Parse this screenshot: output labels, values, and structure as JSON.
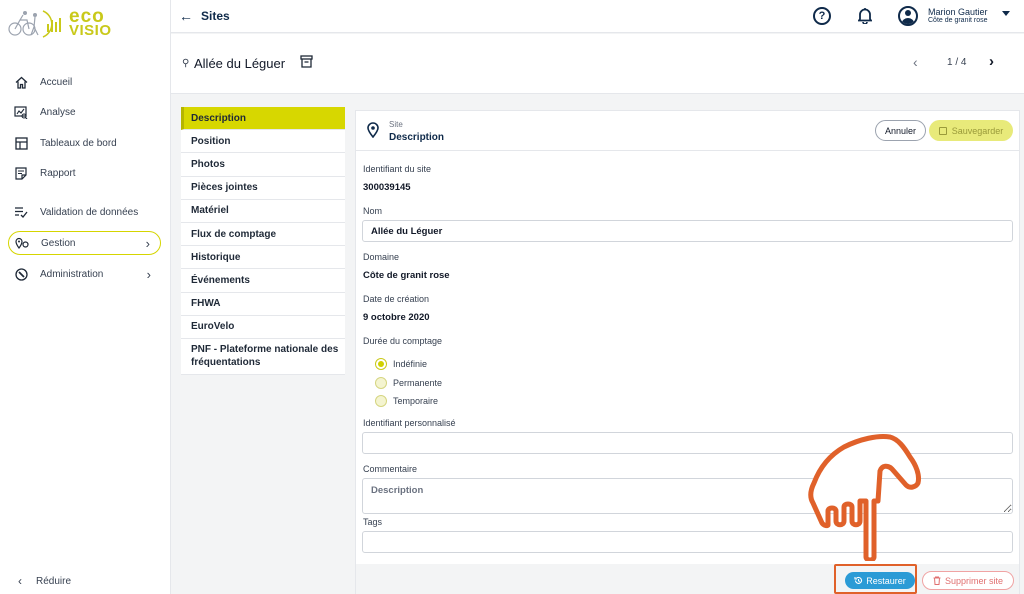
{
  "brand": {
    "word1": "eco",
    "word2": "VISIO"
  },
  "sidebar": {
    "items": [
      {
        "label": "Accueil",
        "icon": "home-icon"
      },
      {
        "label": "Analyse",
        "icon": "analysis-icon"
      },
      {
        "label": "Tableaux de bord",
        "icon": "dashboard-icon"
      },
      {
        "label": "Rapport",
        "icon": "report-icon"
      },
      {
        "label": "Validation de données",
        "icon": "validation-icon"
      },
      {
        "label": "Gestion",
        "icon": "gestion-icon",
        "active": true
      },
      {
        "label": "Administration",
        "icon": "wrench-icon"
      }
    ],
    "reduce_label": "Réduire"
  },
  "topbar": {
    "title": "Sites",
    "help_glyph": "?",
    "user_name": "Marion Gautier",
    "user_org": "Côte de granit rose"
  },
  "site": {
    "name": "Allée du Léguer",
    "pager": "1 / 4"
  },
  "tabs": [
    "Description",
    "Position",
    "Photos",
    "Pièces jointes",
    "Matériel",
    "Flux de comptage",
    "Historique",
    "Événements",
    "FHWA",
    "EuroVelo",
    "PNF - Plateforme nationale des fréquentations"
  ],
  "panel": {
    "kicker": "Site",
    "heading": "Description",
    "cancel_label": "Annuler",
    "save_label": "Sauvegarder",
    "id_label": "Identifiant du site",
    "id_value": "300039145",
    "name_label": "Nom",
    "name_value": "Allée du Léguer",
    "domain_label": "Domaine",
    "domain_value": "Côte de granit rose",
    "created_label": "Date de création",
    "created_value": "9 octobre 2020",
    "duration_label": "Durée du comptage",
    "duration_options": [
      "Indéfinie",
      "Permanente",
      "Temporaire"
    ],
    "duration_selected": "Indéfinie",
    "custom_id_label": "Identifiant personnalisé",
    "custom_id_value": "",
    "comment_label": "Commentaire",
    "comment_placeholder": "Description",
    "tags_label": "Tags",
    "tags_value": "",
    "restore_label": "Restaurer",
    "delete_label": "Supprimer site"
  },
  "colors": {
    "brand": "#c9c91a",
    "tab_active": "#d7d700",
    "navy": "#0f2a4a",
    "restore": "#2b9bd6",
    "highlight": "#e0612a"
  }
}
